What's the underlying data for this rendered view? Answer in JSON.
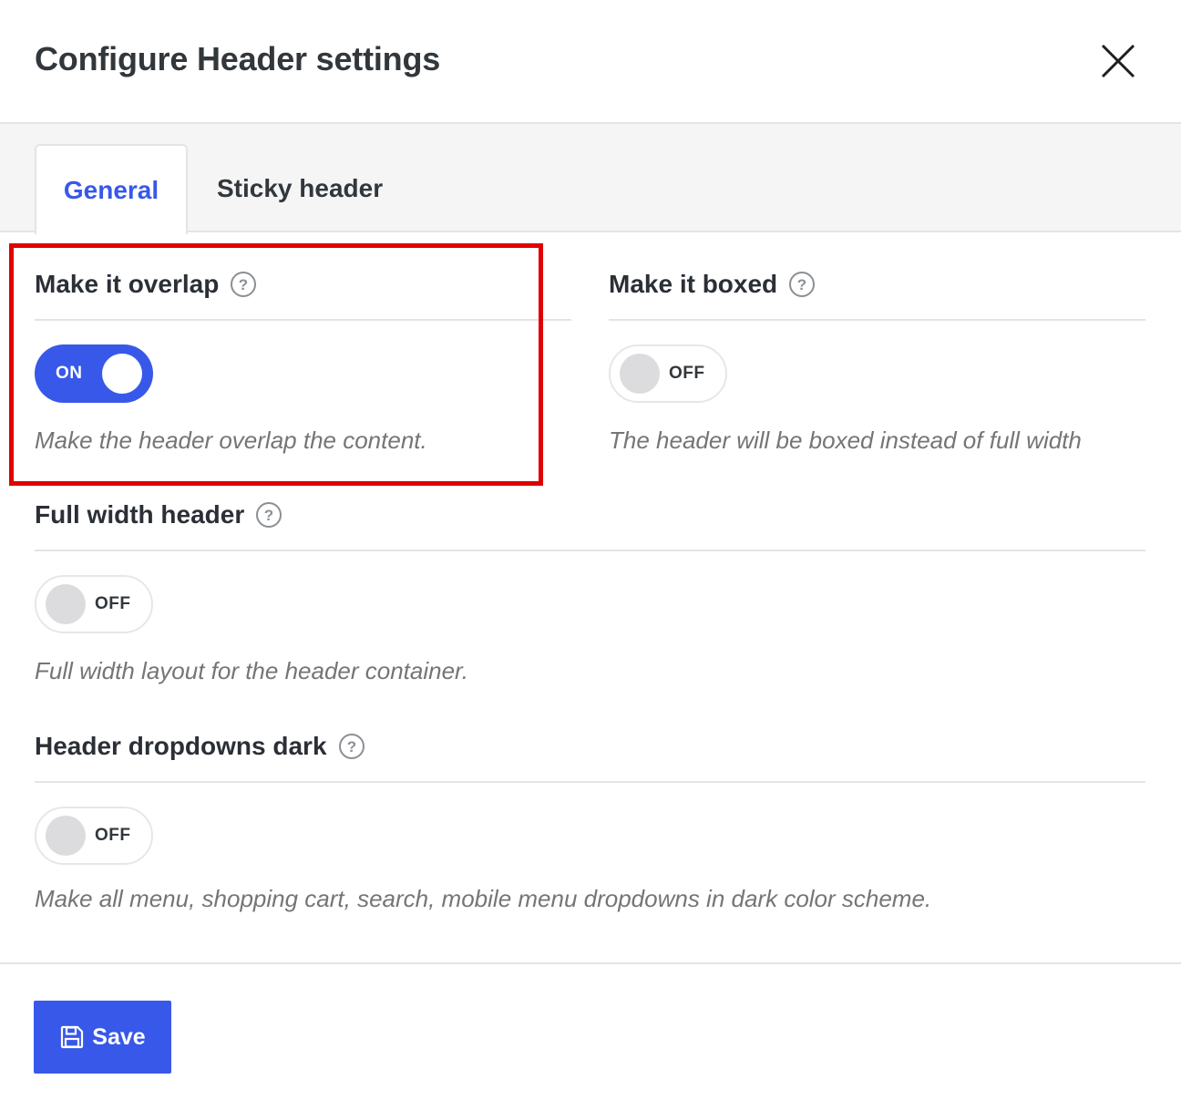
{
  "dialog": {
    "title": "Configure Header settings"
  },
  "tabs": [
    {
      "label": "General",
      "active": true
    },
    {
      "label": "Sticky header",
      "active": false
    }
  ],
  "settings": [
    {
      "label": "Make it overlap",
      "state": "ON",
      "enabled": true,
      "description": "Make the header overlap the content.",
      "highlighted": true
    },
    {
      "label": "Make it boxed",
      "state": "OFF",
      "enabled": false,
      "description": "The header will be boxed instead of full width"
    },
    {
      "label": "Full width header",
      "state": "OFF",
      "enabled": false,
      "description": "Full width layout for the header container."
    },
    {
      "label": "Header dropdowns dark",
      "state": "OFF",
      "enabled": false,
      "description": "Make all menu, shopping cart, search, mobile menu dropdowns in dark color scheme."
    }
  ],
  "footer": {
    "save_label": "Save"
  },
  "icons": {
    "close": "close-icon",
    "help": "help-icon",
    "save": "save-icon"
  },
  "colors": {
    "accent": "#3858e9",
    "highlight": "#e00000",
    "muted_text": "#757575"
  }
}
